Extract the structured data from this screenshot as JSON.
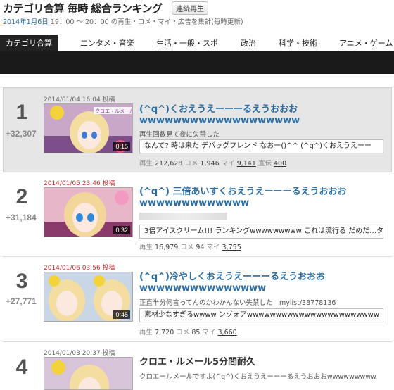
{
  "header": {
    "title": "カテゴリ合算 毎時 総合ランキング",
    "continuous_play": "連続再生",
    "date": "2014年1月6日",
    "subline_rest": " 19：00 〜 20：00 の再生・コメ・マイ・広告を集計(毎時更新)"
  },
  "tabs": [
    "カテゴリ合算",
    "エンタメ・音楽",
    "生活・一般・スポ",
    "政治",
    "科学・技術",
    "アニメ・ゲーム"
  ],
  "entries": [
    {
      "rank": "1",
      "delta": "+32,307",
      "posted": "2014/01/04 16:04 投稿",
      "duration": "0:15",
      "title": "(^q^)くおえうえーーーるえうおおおwwwwwwwwwwwwwwwwwww",
      "desc": "再生回数見て夜に失禁した",
      "comment": "なんて? 時は来た デバッグフレンド なおー()^^ (^q^)くおえうえーー",
      "stats": {
        "play_label": "再生",
        "play": "212,628",
        "comment_label": "コメ",
        "comments": "1,946",
        "mylist_label": "マイ",
        "mylist": "9,141",
        "ad_label": "宣伝",
        "ads": "400"
      }
    },
    {
      "rank": "2",
      "delta": "+31,184",
      "posted": "2014/01/05 23:46 投稿",
      "duration": "0:32",
      "title": "(^q^) 三倍あいすくおえうえーーーるえうおおおwwwwwwwwwwwww",
      "comment": "3倍アイスクリーム!!! ランキングwwwwwwwww これは流行る だめだ…タイ",
      "stats": {
        "play_label": "再生",
        "play": "16,979",
        "comment_label": "コメ",
        "comments": "94",
        "mylist_label": "マイ",
        "mylist": "3,755"
      }
    },
    {
      "rank": "3",
      "delta": "+27,771",
      "posted": "2014/01/06 03:56 投稿",
      "duration": "0:45",
      "title": "(^q^)冷やしくおえうえーーーるえうおおおwwwwwwwwwwwwwww",
      "desc": "正直半分何言ってんのかわかんない失禁した　mylist/38778136",
      "comment": "素材少なすぎるwwww ンゾォアwwwwwwwwwwwwwwwwwwwwwww",
      "stats": {
        "play_label": "再生",
        "play": "7,720",
        "comment_label": "コメ",
        "comments": "85",
        "mylist_label": "マイ",
        "mylist": "3,660"
      }
    },
    {
      "rank": "4",
      "posted": "2014/01/03 20:37 投稿",
      "title": "クロエ・ルメール5分間耐久",
      "desc": "クロエールメールですよ(^q^)くおえうえーーーるえうおおおwwwwwwwww"
    }
  ],
  "thumb_caption": "クロエ・ルメール",
  "colors": {
    "link": "#2b6da3",
    "posted_recent": "#c03030",
    "tab_bar": "#222222",
    "highlight_row": "#e6e6e6"
  }
}
